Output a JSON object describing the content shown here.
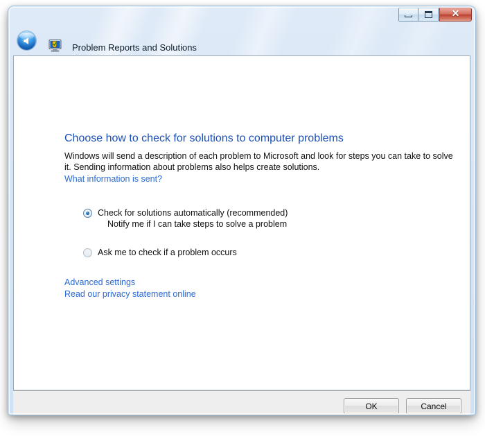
{
  "window": {
    "title": "Problem Reports and Solutions",
    "icon": "problem-reports-icon",
    "back_icon": "back-arrow-icon",
    "controls": {
      "minimize_label": "—",
      "maximize_label": "□",
      "close_label": "✕"
    }
  },
  "content": {
    "heading": "Choose how to check for solutions to computer problems",
    "body": "Windows will send a description of each problem to Microsoft and look for steps you can take to solve it. Sending information about problems also helps create solutions.",
    "what_info_link": "What information is sent?",
    "options": [
      {
        "label": "Check for solutions automatically (recommended)",
        "sub_label": "Notify me if I can take steps to solve a problem",
        "selected": true
      },
      {
        "label": "Ask me to check if a problem occurs",
        "sub_label": "",
        "selected": false
      }
    ],
    "links": [
      "Advanced settings",
      "Read our privacy statement online"
    ]
  },
  "footer": {
    "ok_label": "OK",
    "cancel_label": "Cancel"
  },
  "colors": {
    "heading_blue": "#1c4fb3",
    "link_blue": "#2a6ad4",
    "close_red": "#bb4230",
    "glass_blue": "#d7e6f6"
  }
}
